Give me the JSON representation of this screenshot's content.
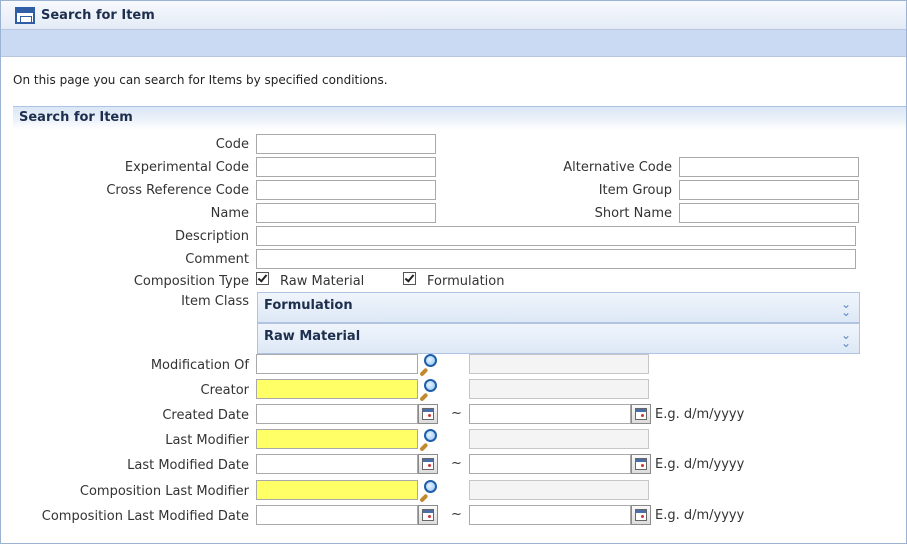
{
  "window": {
    "title": "Search for Item",
    "intro": "On this page you can search for Items by specified conditions."
  },
  "panel": {
    "title": "Search for Item"
  },
  "fields": {
    "code": {
      "label": "Code",
      "value": ""
    },
    "experimental_code": {
      "label": "Experimental Code",
      "value": ""
    },
    "alternative_code": {
      "label": "Alternative Code",
      "value": ""
    },
    "cross_reference_code": {
      "label": "Cross Reference Code",
      "value": ""
    },
    "item_group": {
      "label": "Item Group",
      "value": ""
    },
    "name": {
      "label": "Name",
      "value": ""
    },
    "short_name": {
      "label": "Short Name",
      "value": ""
    },
    "description": {
      "label": "Description",
      "value": ""
    },
    "comment": {
      "label": "Comment",
      "value": ""
    }
  },
  "composition_type": {
    "label": "Composition Type",
    "options": [
      {
        "label": "Raw Material",
        "checked": true
      },
      {
        "label": "Formulation",
        "checked": true
      }
    ]
  },
  "item_class": {
    "label": "Item Class",
    "sections": [
      "Formulation",
      "Raw Material"
    ]
  },
  "lookups": {
    "modification_of": {
      "label": "Modification Of",
      "value": "",
      "display": ""
    },
    "creator": {
      "label": "Creator",
      "value": "",
      "display": ""
    },
    "last_modifier": {
      "label": "Last Modifier",
      "value": "",
      "display": ""
    },
    "composition_last_modifier": {
      "label": "Composition Last Modifier",
      "value": "",
      "display": ""
    }
  },
  "dates": {
    "created_date": {
      "label": "Created Date",
      "from": "",
      "to": ""
    },
    "last_modified_date": {
      "label": "Last Modified Date",
      "from": "",
      "to": ""
    },
    "composition_last_modified_date": {
      "label": "Composition Last Modified Date",
      "from": "",
      "to": ""
    },
    "range_separator": "~",
    "format_hint": "E.g. d/m/yyyy"
  },
  "colors": {
    "required_field": "#ffff66",
    "header_blue": "#c9daf2",
    "title_text": "#1e2f4e"
  },
  "icons": {
    "title": "window-icon",
    "lookup": "magnifier-icon",
    "calendar": "calendar-icon",
    "expand": "double-chevron-down-icon"
  }
}
